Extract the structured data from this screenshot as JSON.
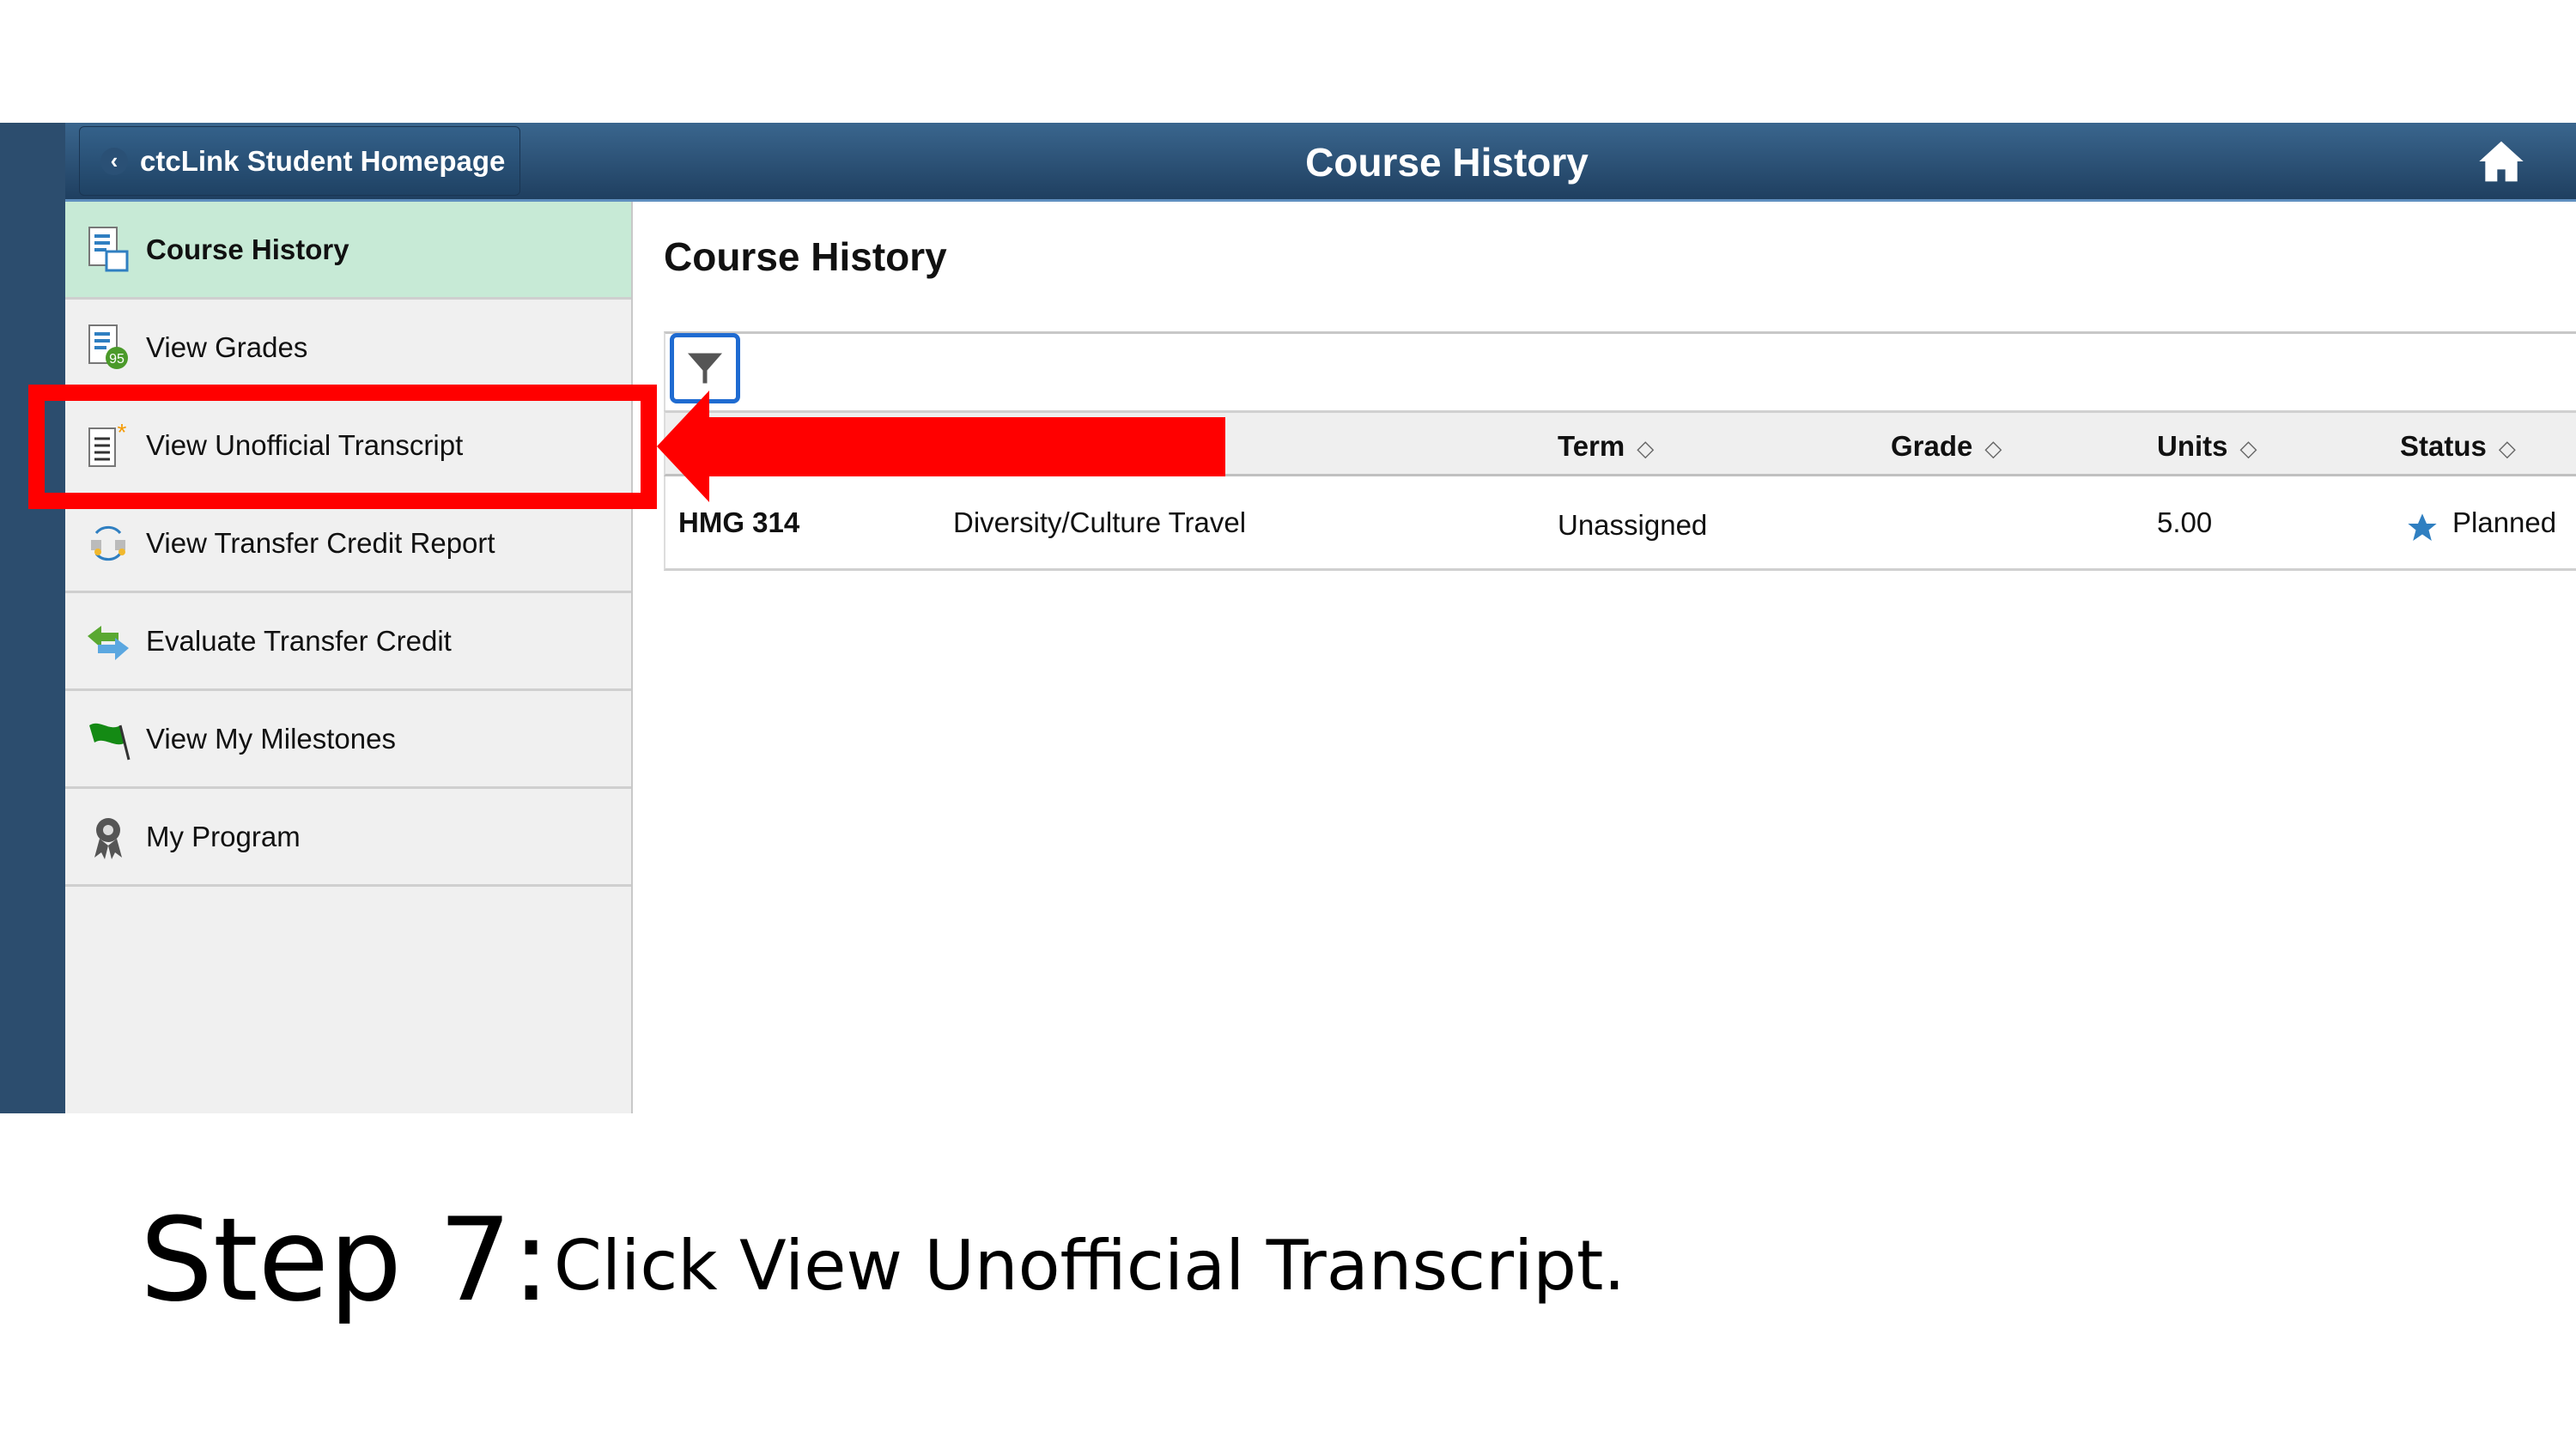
{
  "header": {
    "back_label": "ctcLink Student Homepage",
    "title": "Course History",
    "home_icon": "home-icon"
  },
  "sidebar": {
    "items": [
      {
        "label": "Course History",
        "icon": "course-history-icon",
        "active": true
      },
      {
        "label": "View Grades",
        "icon": "grades-icon",
        "badge": "95"
      },
      {
        "label": "View Unofficial Transcript",
        "icon": "transcript-icon"
      },
      {
        "label": "View Transfer Credit Report",
        "icon": "transfer-report-icon"
      },
      {
        "label": "Evaluate Transfer Credit",
        "icon": "arrows-icon"
      },
      {
        "label": "View My Milestones",
        "icon": "flag-icon"
      },
      {
        "label": "My Program",
        "icon": "ribbon-icon"
      }
    ]
  },
  "main": {
    "title": "Course History",
    "table": {
      "columns": [
        "Term",
        "Grade",
        "Units",
        "Status"
      ],
      "rows": [
        {
          "course": "HMG 314",
          "description": "Diversity/Culture Travel",
          "term": "Unassigned",
          "grade": "",
          "units": "5.00",
          "status": "Planned"
        }
      ]
    }
  },
  "caption": {
    "step": "Step 7:",
    "instruction": "Click View Unofficial Transcript."
  },
  "colors": {
    "header": "#2c4d6e",
    "active": "#c7ead6",
    "highlight": "#ff0000",
    "star": "#2f7fc1"
  }
}
